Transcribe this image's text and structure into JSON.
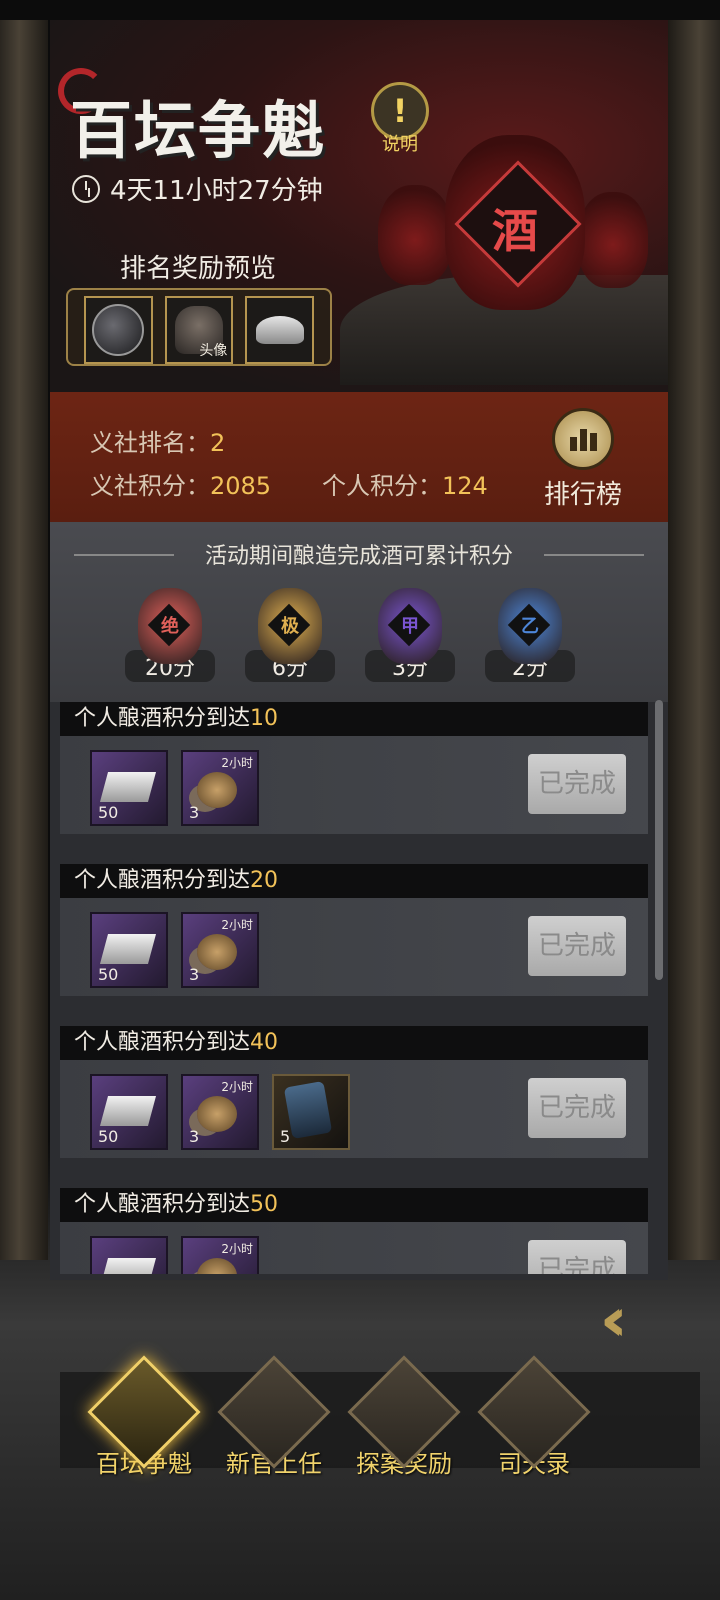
{
  "header": {
    "title": "百坛争魁",
    "help_icon": "!",
    "help_label": "说明",
    "countdown": "4天11小时27分钟",
    "preview_title": "排名奖励预览",
    "preview_items": [
      {
        "icon": "avatar-frame-icon",
        "tag": ""
      },
      {
        "icon": "portrait-icon",
        "tag": "头像"
      },
      {
        "icon": "silver-ingot-icon",
        "tag": ""
      }
    ],
    "jar_char": "酒"
  },
  "rank": {
    "rank_label": "义社排名：",
    "rank_value": "2",
    "score_label": "义社积分：",
    "score_value": "2085",
    "personal_label": "个人积分：",
    "personal_value": "124",
    "leaderboard_label": "排行榜"
  },
  "points": {
    "caption": "活动期间酿造完成酒可累计积分",
    "grades": [
      {
        "char": "绝",
        "points": "20分",
        "color": "#e0605a"
      },
      {
        "char": "极",
        "points": "6分",
        "color": "#e0b050"
      },
      {
        "char": "甲",
        "points": "3分",
        "color": "#7a55d0"
      },
      {
        "char": "乙",
        "points": "2分",
        "color": "#4d86d8"
      }
    ]
  },
  "quests": [
    {
      "prefix": "个人酿酒积分到达",
      "target": "10",
      "rewards": [
        {
          "type": "silver",
          "count": "50",
          "time": ""
        },
        {
          "type": "coins",
          "count": "3",
          "time": "2小时"
        }
      ],
      "status": "已完成"
    },
    {
      "prefix": "个人酿酒积分到达",
      "target": "20",
      "rewards": [
        {
          "type": "silver",
          "count": "50",
          "time": ""
        },
        {
          "type": "coins",
          "count": "3",
          "time": "2小时"
        }
      ],
      "status": "已完成"
    },
    {
      "prefix": "个人酿酒积分到达",
      "target": "40",
      "rewards": [
        {
          "type": "silver",
          "count": "50",
          "time": ""
        },
        {
          "type": "coins",
          "count": "3",
          "time": "2小时"
        },
        {
          "type": "token",
          "count": "5",
          "time": ""
        }
      ],
      "status": "已完成"
    },
    {
      "prefix": "个人酿酒积分到达",
      "target": "50",
      "rewards": [
        {
          "type": "silver",
          "count": "",
          "time": ""
        },
        {
          "type": "coins",
          "count": "",
          "time": "2小时"
        }
      ],
      "status": "已完成"
    }
  ],
  "back_icon": "double-chevron-left-icon",
  "nav": [
    {
      "label": "百坛争魁",
      "active": true
    },
    {
      "label": "新官上任",
      "active": false
    },
    {
      "label": "探案奖励",
      "active": false
    },
    {
      "label": "司天录",
      "active": false
    }
  ]
}
